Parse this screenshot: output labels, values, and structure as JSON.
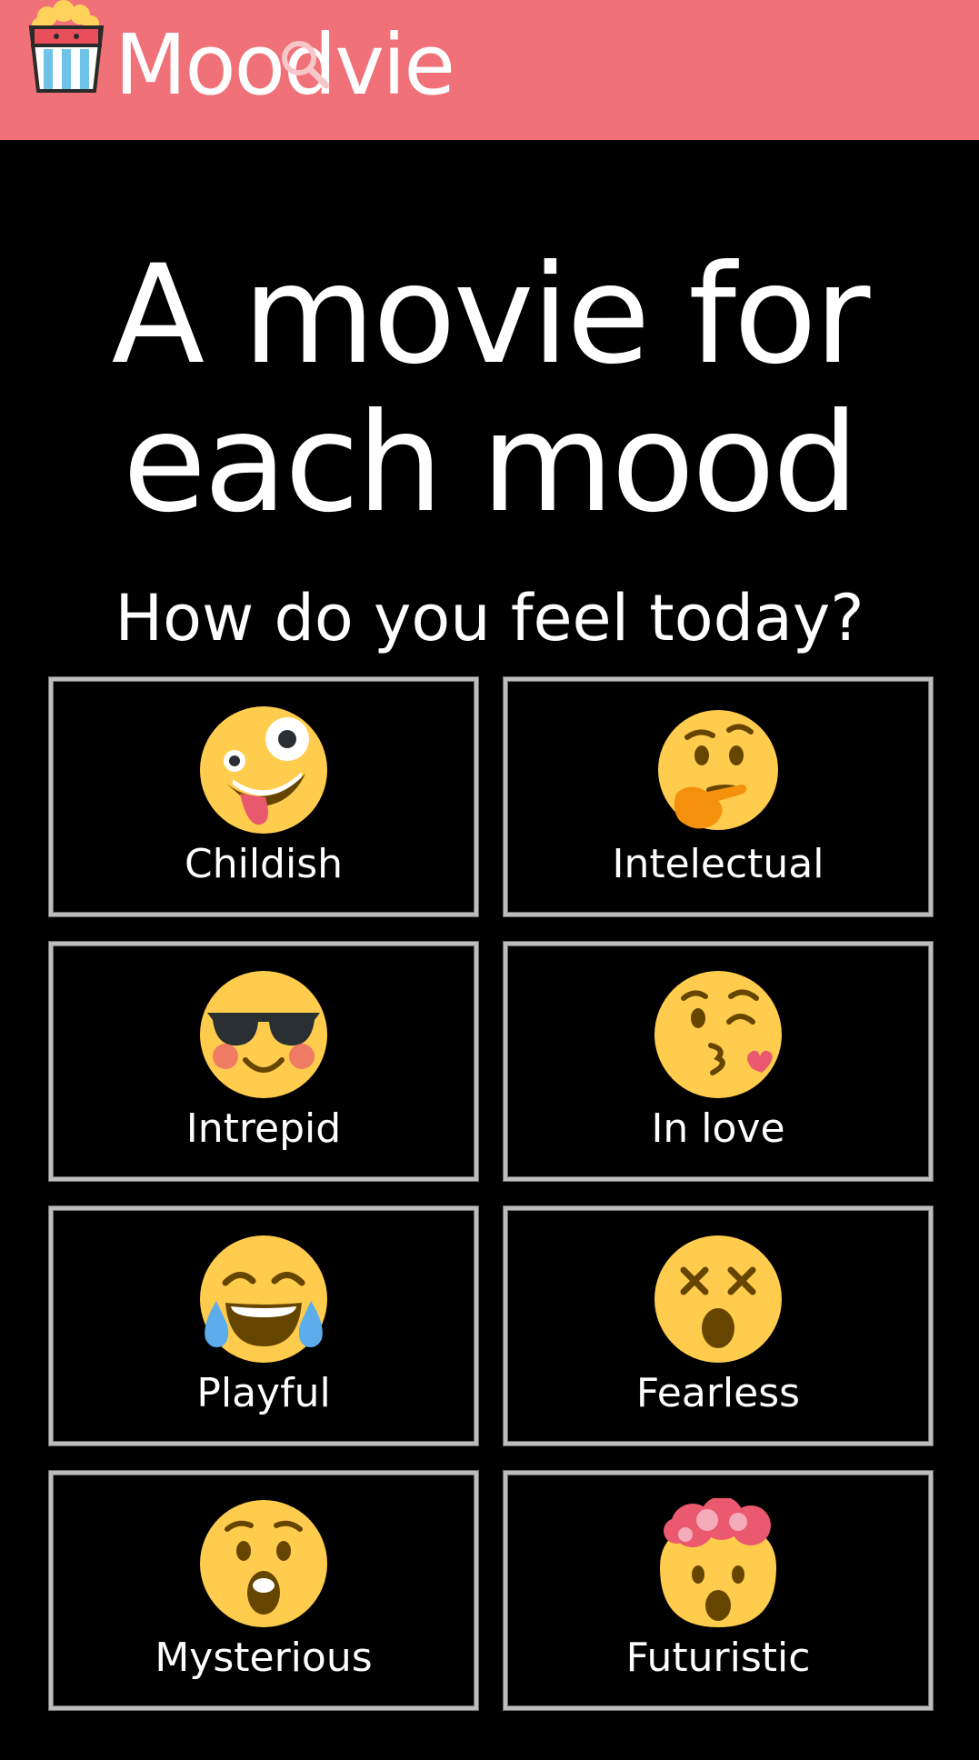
{
  "header": {
    "logo_icon": "popcorn-icon",
    "brand": "Moodvie",
    "background": "#F07178"
  },
  "hero": {
    "title_line1": "A movie for",
    "title_line2": "each mood",
    "subtitle": "How do you feel today?"
  },
  "moods": [
    {
      "label": "Childish",
      "icon": "zany-face-icon"
    },
    {
      "label": "Intelectual",
      "icon": "thinking-face-icon"
    },
    {
      "label": "Intrepid",
      "icon": "sunglasses-face-icon"
    },
    {
      "label": "In love",
      "icon": "kissing-face-icon"
    },
    {
      "label": "Playful",
      "icon": "tears-of-joy-face-icon"
    },
    {
      "label": "Fearless",
      "icon": "dizzy-face-icon"
    },
    {
      "label": "Mysterious",
      "icon": "surprised-face-icon"
    },
    {
      "label": "Futuristic",
      "icon": "exploding-head-icon"
    }
  ],
  "colors": {
    "accent": "#F07178",
    "emoji_yellow": "#FFCC4D",
    "card_border": "#BDBDBD"
  }
}
